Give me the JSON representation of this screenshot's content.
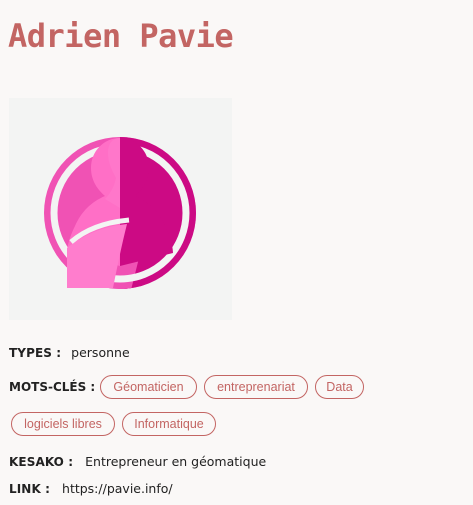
{
  "colors": {
    "accent": "#c36563",
    "text": "#222222",
    "background": "#faf8f7",
    "avatar_magenta": "#cc0a84",
    "avatar_pink": "#f052b4"
  },
  "profile": {
    "name": "Adrien Pavie",
    "avatar_icon": "person-silhouette-icon"
  },
  "fields": {
    "types": {
      "label": "TYPES :",
      "value": "personne"
    },
    "tags_label": "MOTS-CLÉS :",
    "tags": [
      "Géomaticien",
      "entreprenariat",
      "Data",
      "logiciels libres",
      "Informatique"
    ],
    "kesako": {
      "label": "KESAKO :",
      "value": "Entrepreneur en géomatique"
    },
    "link": {
      "label": "LINK :",
      "value": "https://pavie.info/"
    }
  }
}
